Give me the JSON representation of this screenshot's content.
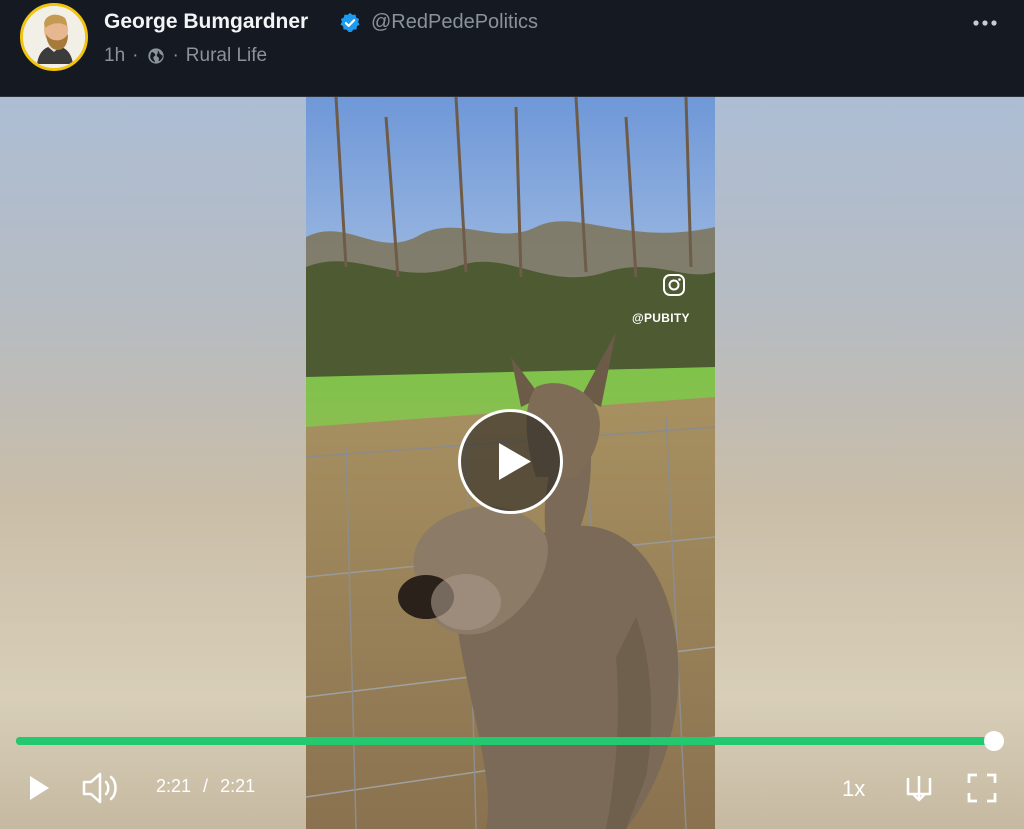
{
  "post": {
    "author_name": "George Bumgardner",
    "handle": "@RedPedePolitics",
    "time_ago": "1h",
    "separator": "·",
    "community": "Rural Life",
    "verified": true
  },
  "video": {
    "watermark": "@PUBITY",
    "progress": 1.0,
    "current_time": "2:21",
    "time_separator": "/",
    "duration": "2:21",
    "speed": "1x"
  },
  "icons": {
    "avatar": "avatar-illustration",
    "verified": "verified-badge-icon",
    "globe": "globe-icon",
    "more": "more-options-icon",
    "instagram": "instagram-icon",
    "play_center": "play-circle-icon",
    "play": "play-icon",
    "volume": "volume-icon",
    "download": "download-icon",
    "fullscreen": "fullscreen-icon"
  },
  "colors": {
    "background": "#151a22",
    "progress": "#22c96f",
    "verified": "#1d9bf0",
    "avatar_ring": "#f2c40f"
  }
}
